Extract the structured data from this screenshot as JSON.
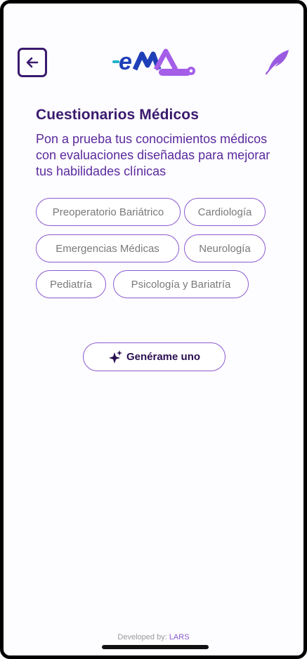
{
  "header": {
    "back_icon": "arrow-left-icon",
    "logo_text": "eMa",
    "feather_icon": "feather-icon"
  },
  "main": {
    "title": "Cuestionarios Médicos",
    "subtitle": "Pon a prueba tus conocimientos médicos con evaluaciones diseñadas para mejorar tus habilidades clínicas",
    "chips": [
      "Preoperatorio Bariátrico",
      "Cardiología",
      "Emergencias Médicas",
      "Neurología",
      "Pediatría",
      "Psicología y Bariatría"
    ],
    "generate_label": "Genérame uno",
    "generate_icon": "sparkles-icon"
  },
  "footer": {
    "prefix": "Developed by:",
    "brand": "LARS"
  },
  "colors": {
    "primary_dark": "#3a1a6e",
    "accent_purple": "#8a5ad0",
    "logo_blue": "#1f3fb8",
    "logo_purple": "#a45ee8"
  }
}
